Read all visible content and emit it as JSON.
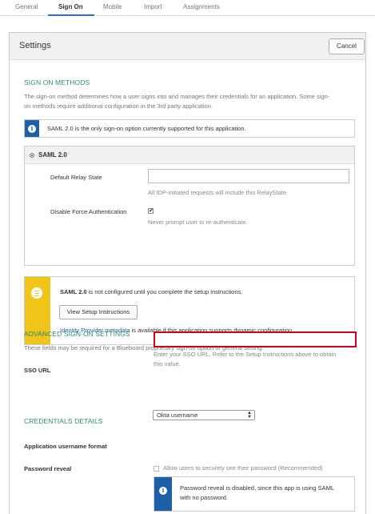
{
  "tabs": [
    {
      "label": "General"
    },
    {
      "label": "Sign On"
    },
    {
      "label": "Mobile"
    },
    {
      "label": "Import"
    },
    {
      "label": "Assignments"
    }
  ],
  "panel": {
    "title": "Settings",
    "cancel_label": "Cancel"
  },
  "sign_on_methods": {
    "title": "SIGN ON METHODS",
    "description_line1": "The sign-on method determines how a user signs into and manages their credentials for an application. Some sign-",
    "description_line2": "on methods require additional configuration in the 3rd party application.",
    "info": "SAML 2.0 is the only sign-on option currently supported for this application."
  },
  "saml": {
    "option_label": "SAML 2.0",
    "relay_state_label": "Default Relay State",
    "relay_state_value": "",
    "relay_state_hint": "All IDP-initiated requests will include this RelayState",
    "disable_force_auth_label": "Disable Force Authentication",
    "disable_force_auth_checked": true,
    "disable_force_auth_hint": "Never prompt user to re-authenticate."
  },
  "setup": {
    "strong": "SAML 2.0",
    "message": " is not configured until you complete the setup instructions.",
    "button_label": "View Setup Instructions",
    "metadata_link": "Identity Provider metadata",
    "metadata_suffix": " is available if this application supports dynamic configuration."
  },
  "advanced": {
    "title": "ADVANCED SIGN-ON SETTINGS",
    "description": "These fields may be required for a Blueboard proprietary sign-on option or general setting.",
    "sso_label": "SSO URL",
    "sso_value": "",
    "sso_hint_line1": "Enter your SSO URL. Refer to the Setup Instructions above to obtain",
    "sso_hint_line2": "this value."
  },
  "credentials": {
    "title": "CREDENTIALS DETAILS",
    "username_format_label": "Application username format",
    "username_format_value": "Okta username",
    "password_reveal_label": "Password reveal",
    "password_reveal_option": "Allow users to securely see their password (Recommended)",
    "password_reveal_checked": false,
    "info_line1": "Password reveal is disabled, since this app is using SAML",
    "info_line2": "with no password."
  },
  "colors": {
    "accent_green": "#2e8b6e",
    "info_blue": "#1d5fa8",
    "warning_yellow": "#f0c419",
    "error_red": "#d0021b"
  }
}
